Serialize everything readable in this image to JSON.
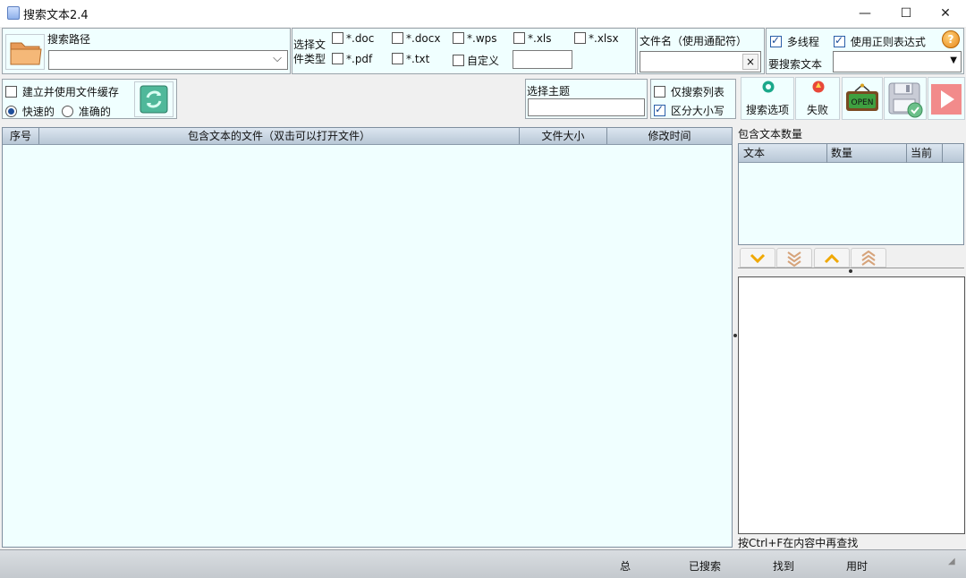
{
  "window": {
    "title": "搜索文本2.4",
    "minimize": "—",
    "maximize": "☐",
    "close": "✕"
  },
  "path": {
    "label": "搜索路径",
    "value": ""
  },
  "filetypes": {
    "label": "选择文件类型",
    "options": [
      {
        "label": "*.doc",
        "checked": false
      },
      {
        "label": "*.docx",
        "checked": false
      },
      {
        "label": "*.wps",
        "checked": false
      },
      {
        "label": "*.xls",
        "checked": false
      },
      {
        "label": "*.xlsx",
        "checked": false
      },
      {
        "label": "*.pdf",
        "checked": false
      },
      {
        "label": "*.txt",
        "checked": false
      },
      {
        "label": "自定义",
        "checked": false
      }
    ],
    "custom_value": ""
  },
  "filename": {
    "label": "文件名（使用通配符）",
    "value": "",
    "clear": "×"
  },
  "options": {
    "multithread": {
      "label": "多线程",
      "checked": true
    },
    "regex": {
      "label": "使用正则表达式",
      "checked": true
    },
    "help": "?",
    "search_text_label": "要搜索文本",
    "search_text_value": ""
  },
  "cache": {
    "label": "建立并使用文件缓存",
    "checked": false,
    "fast": "快速的",
    "accurate": "准确的",
    "selected": "fast"
  },
  "theme": {
    "label": "选择主题",
    "value": ""
  },
  "list_options": {
    "only_list": {
      "label": "仅搜索列表",
      "checked": false
    },
    "case": {
      "label": "区分大小写",
      "checked": true
    }
  },
  "toolbar": {
    "search_options": "搜索选项",
    "fail": "失败",
    "open": "OPEN"
  },
  "results_table": {
    "columns": [
      "序号",
      "包含文本的文件（双击可以打开文件）",
      "文件大小",
      "修改时间"
    ],
    "rows": []
  },
  "count_panel": {
    "label": "包含文本数量",
    "columns": [
      "文本",
      "数量",
      "当前"
    ],
    "rows": []
  },
  "content": {
    "hint": "按Ctrl+F在内容中再查找"
  },
  "status": {
    "total": "总",
    "searched": "已搜索",
    "found": "找到",
    "time": "用时"
  }
}
